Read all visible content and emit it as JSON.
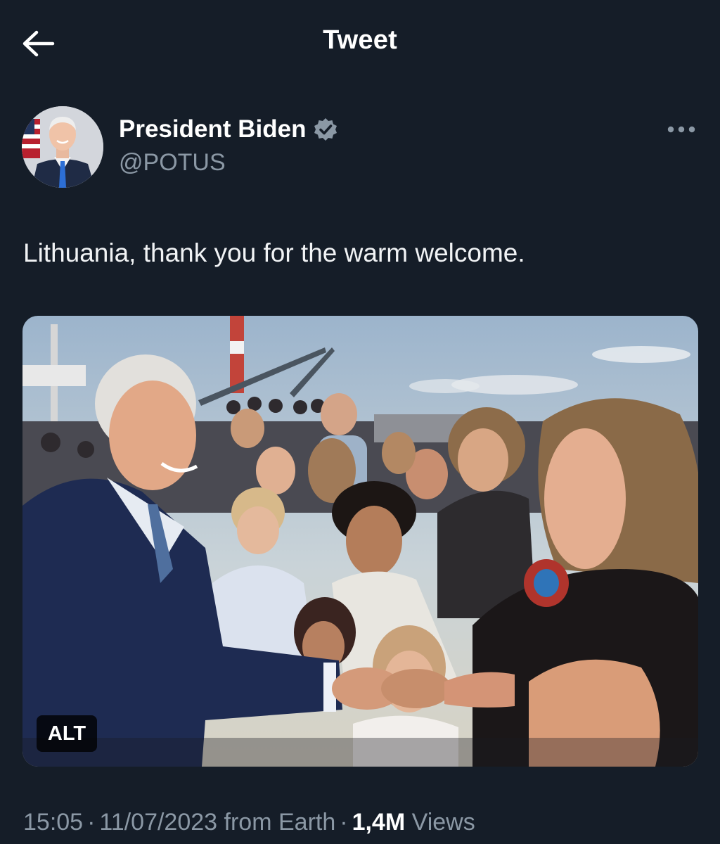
{
  "header": {
    "title": "Tweet",
    "back_icon": "arrow-left-icon"
  },
  "author": {
    "name": "President Biden",
    "handle": "@POTUS",
    "verified_icon": "verified-badge-icon",
    "more_icon": "more-horizontal-icon"
  },
  "tweet": {
    "text": "Lithuania, thank you for the warm welcome.",
    "media_alt_label": "ALT"
  },
  "meta": {
    "time": "15:05",
    "separator": "·",
    "date": "11/07/2023",
    "source": "from Earth",
    "views_count": "1,4M",
    "views_label": "Views"
  },
  "colors": {
    "background": "#151d28",
    "text_primary": "#ffffff",
    "text_secondary": "#8b98a5",
    "verified_badge": "#8b98a5"
  }
}
